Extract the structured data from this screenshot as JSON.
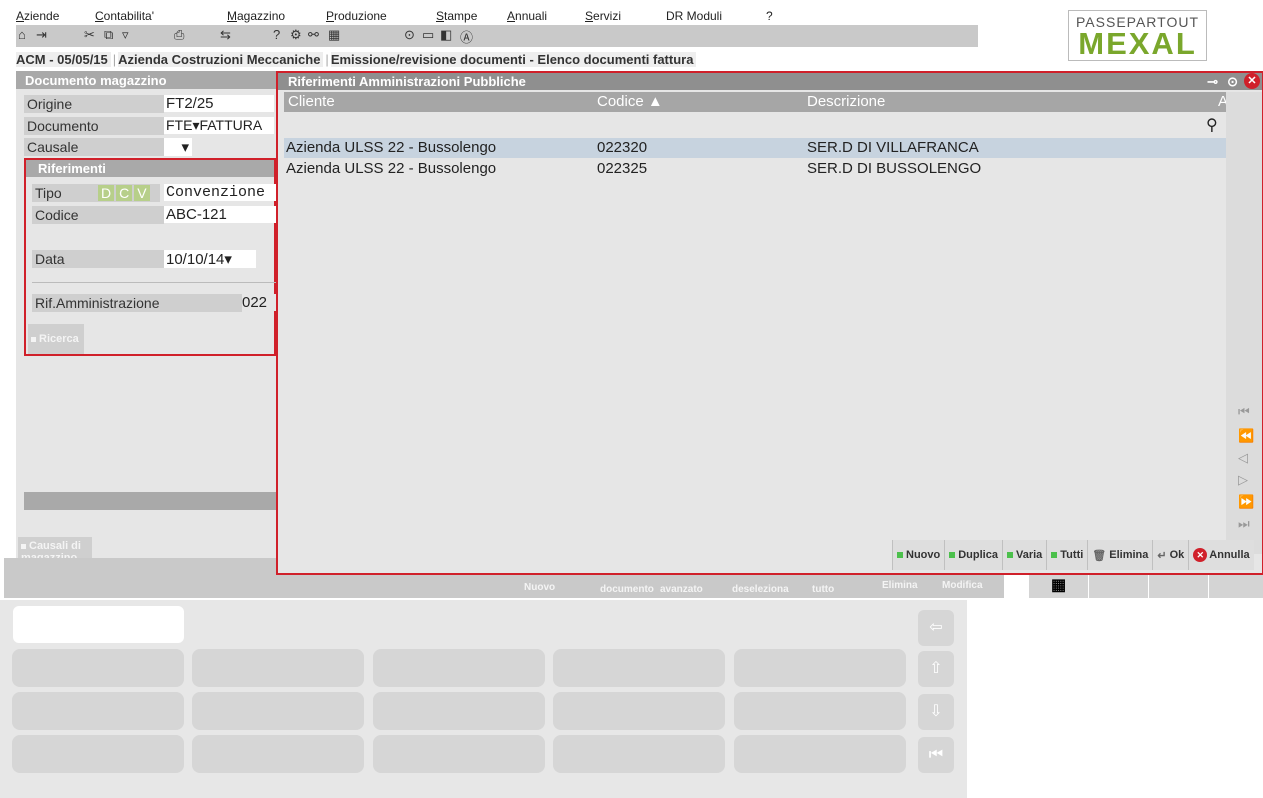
{
  "menu": [
    "Aziende",
    "Contabilita'",
    "Magazzino",
    "Produzione",
    "Stampe",
    "Annuali",
    "Servizi",
    "DR  Moduli",
    "?"
  ],
  "logo": {
    "line1": "PASSEPARTOUT",
    "line2": "MEXAL"
  },
  "breadcrumb": [
    "ACM - 05/05/15",
    "Azienda Costruzioni Meccaniche",
    "Emissione/revisione documenti - Elenco documenti fattura"
  ],
  "left_panel": {
    "title": "Documento magazzino",
    "origine_label": "Origine",
    "origine_value": "FT2/25",
    "documento_label": "Documento",
    "documento_value": "FTE▾FATTURA",
    "causale_label": "Causale",
    "causale_value": "▾",
    "riferimenti": {
      "title": "Riferimenti",
      "tipo_label": "Tipo",
      "tipo_options": [
        "D",
        "C",
        "V"
      ],
      "tipo_value": "Convenzione",
      "codice_label": "Codice",
      "codice_value": "ABC-121",
      "data_label": "Data",
      "data_value": "10/10/14▾",
      "rif_label": "Rif.Amministrazione",
      "rif_value": "022",
      "ricerca_label": "Ricerca"
    },
    "causali_label": "Causali di magazzino"
  },
  "dialog": {
    "title": "Riferimenti Amministrazioni Pubbliche",
    "columns": [
      "Cliente",
      "Codice ▲",
      "Descrizione",
      "A"
    ],
    "rows": [
      {
        "cliente": "Azienda ULSS 22 - Bussolengo",
        "codice": "022320",
        "descrizione": "SER.D DI VILLAFRANCA"
      },
      {
        "cliente": "Azienda ULSS 22 - Bussolengo",
        "codice": "022325",
        "descrizione": "SER.D DI BUSSOLENGO"
      }
    ],
    "buttons": [
      "Nuovo",
      "Duplica",
      "Varia",
      "Tutti",
      "Elimina",
      "Ok",
      "Annulla"
    ]
  },
  "under_buttons": [
    "Nuovo",
    "documento",
    "avanzato",
    "deseleziona",
    "tutto",
    "Elimina",
    "Modifica"
  ]
}
